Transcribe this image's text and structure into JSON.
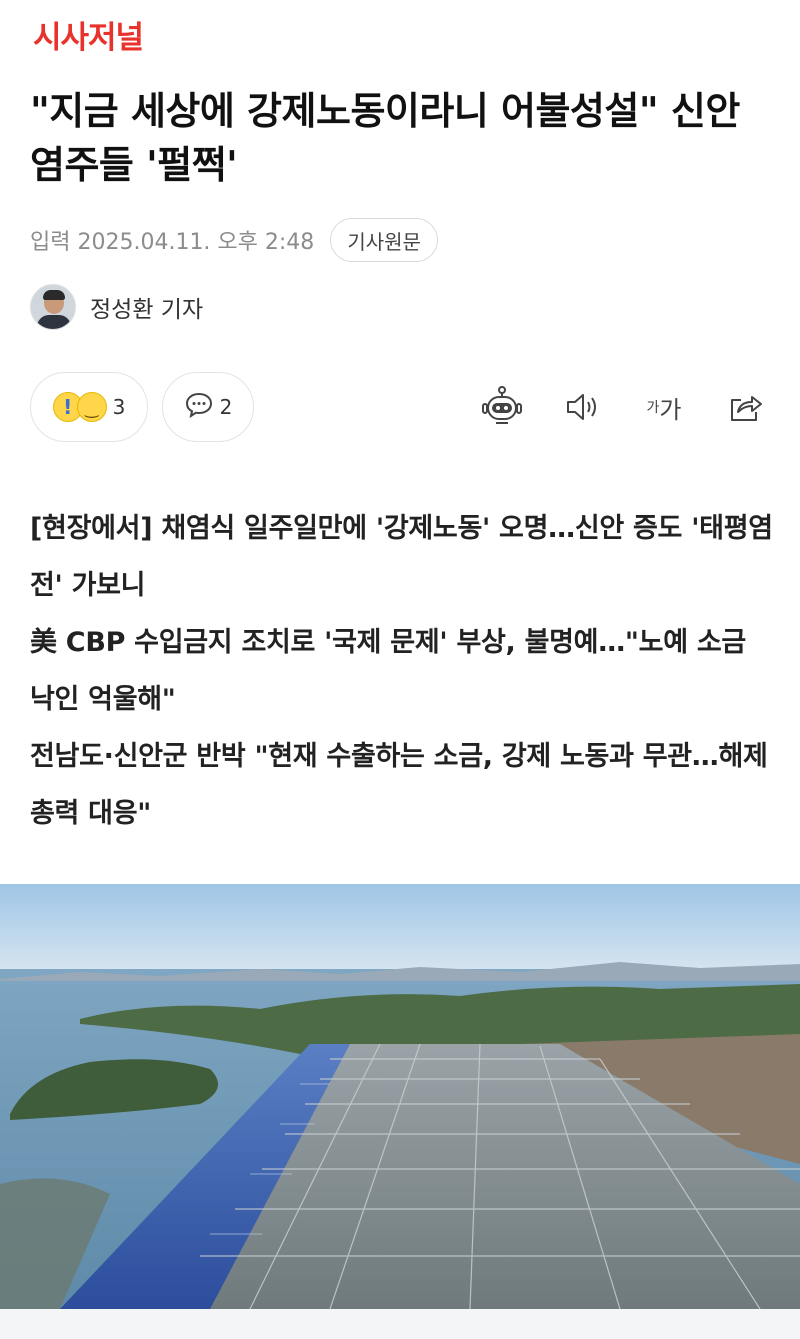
{
  "header": {
    "logo": "시사저널",
    "logo_color": "#e8322c"
  },
  "article": {
    "title": "\"지금 세상에 강제노동이라니 어불성설\" 신안 염주들 '펄쩍'",
    "meta": {
      "date": "입력 2025.04.11. 오후 2:48",
      "origin_button": "기사원문"
    },
    "reporter": {
      "name": "정성환 기자"
    },
    "actions": {
      "reaction_count": "3",
      "comment_count": "2",
      "tools": [
        "robot-summary",
        "audio",
        "font-size",
        "share"
      ],
      "font_size_label_small": "가",
      "font_size_label_large": "가"
    },
    "summary": [
      "[현장에서] 채염식 일주일만에 '강제노동' 오명…신안 증도 '태평염전' 가보니",
      "美 CBP 수입금지 조치로 '국제 문제' 부상, 불명예…\"노예 소금 낙인 억울해\"",
      "전남도·신안군 반박 \"현재 수출하는 소금, 강제 노동과 무관…해제 총력 대응\""
    ]
  },
  "colors": {
    "accent": "#e8322c",
    "meta_gray": "#8c8c8c",
    "border": "#e3e3e3"
  }
}
